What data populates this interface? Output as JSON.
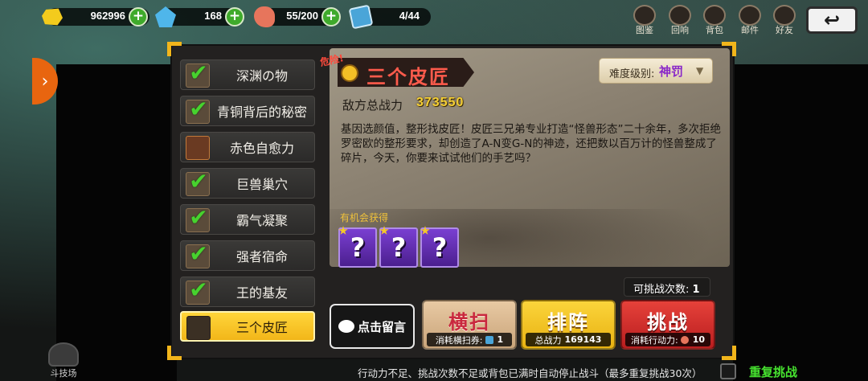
{
  "resources": {
    "gold": "962996",
    "gems": "168",
    "stamina": "55/200",
    "cards": "4/44"
  },
  "top_menu": {
    "items": [
      "图鉴",
      "回响",
      "背包",
      "邮件",
      "好友"
    ]
  },
  "stages": [
    {
      "label": "深渊の物",
      "cleared": true
    },
    {
      "label": "青铜背后的秘密",
      "cleared": true
    },
    {
      "label": "赤色自愈力",
      "cleared": false
    },
    {
      "label": "巨兽巢穴",
      "cleared": true
    },
    {
      "label": "霸气凝聚",
      "cleared": true
    },
    {
      "label": "强者宿命",
      "cleared": true
    },
    {
      "label": "王的基友",
      "cleared": true
    },
    {
      "label": "三个皮匠",
      "cleared": false,
      "active": true
    }
  ],
  "detail": {
    "danger_tag": "危险!",
    "title": "三个皮匠",
    "difficulty_label": "难度级别:",
    "difficulty_value": "神罚",
    "enemy_power_label": "敌方总战力",
    "enemy_power_value": "373550",
    "description": "基因选颜值，整形找皮匠！皮匠三兄弟专业打造“怪兽形态”二十余年，多次拒绝罗密欧的整形要求，却创造了A-N变G-N的神迹，还把数以百万计的怪兽整成了碎片，今天，你要来试试他们的手艺吗？",
    "reward_label": "有机会获得",
    "reward_placeholder": "?"
  },
  "actions": {
    "remaining_label": "可挑战次数:",
    "remaining_value": "1",
    "message_label": "点击留言",
    "sweep_label": "横扫",
    "sweep_cost_label": "消耗横扫券:",
    "sweep_cost_value": "1",
    "lineup_label": "排阵",
    "lineup_power_label": "总战力",
    "lineup_power_value": "169143",
    "fight_label": "挑战",
    "fight_cost_label": "消耗行动力:",
    "fight_cost_value": "10"
  },
  "footer": {
    "tip": "行动力不足、挑战次数不足或背包已满时自动停止战斗（最多重复挑战30次）",
    "repeat_label": "重复挑战",
    "arena_label": "斗技场"
  },
  "colors": {
    "accent_yellow": "#f2b619",
    "danger_red": "#ff5b4c",
    "difficulty_purple": "#8a29c8",
    "repeat_green": "#46e12f"
  }
}
